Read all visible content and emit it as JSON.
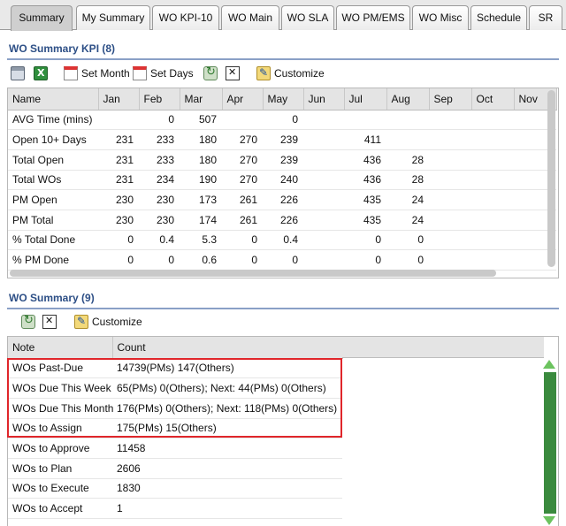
{
  "tabs": [
    {
      "label": "Summary",
      "active": true
    },
    {
      "label": "My Summary"
    },
    {
      "label": "WO KPI-10"
    },
    {
      "label": "WO Main"
    },
    {
      "label": "WO SLA"
    },
    {
      "label": "WO PM/EMS"
    },
    {
      "label": "WO Misc"
    },
    {
      "label": "Schedule"
    },
    {
      "label": "SR"
    }
  ],
  "kpi": {
    "title": "WO Summary KPI (8)",
    "toolbar": {
      "set_month": "Set Month",
      "set_days": "Set Days",
      "customize": "Customize"
    },
    "columns": [
      "Name",
      "Jan",
      "Feb",
      "Mar",
      "Apr",
      "May",
      "Jun",
      "Jul",
      "Aug",
      "Sep",
      "Oct",
      "Nov"
    ],
    "rows": [
      [
        "AVG Time (mins)",
        "",
        "0",
        "507",
        "",
        "0",
        "",
        "",
        "",
        "",
        "",
        ""
      ],
      [
        "Open 10+ Days",
        "231",
        "233",
        "180",
        "270",
        "239",
        "",
        "411",
        "",
        "",
        "",
        ""
      ],
      [
        "Total Open",
        "231",
        "233",
        "180",
        "270",
        "239",
        "",
        "436",
        "28",
        "",
        "",
        ""
      ],
      [
        "Total WOs",
        "231",
        "234",
        "190",
        "270",
        "240",
        "",
        "436",
        "28",
        "",
        "",
        ""
      ],
      [
        "PM Open",
        "230",
        "230",
        "173",
        "261",
        "226",
        "",
        "435",
        "24",
        "",
        "",
        ""
      ],
      [
        "PM Total",
        "230",
        "230",
        "174",
        "261",
        "226",
        "",
        "435",
        "24",
        "",
        "",
        ""
      ],
      [
        "% Total Done",
        "0",
        "0.4",
        "5.3",
        "0",
        "0.4",
        "",
        "0",
        "0",
        "",
        "",
        ""
      ],
      [
        "% PM Done",
        "0",
        "0",
        "0.6",
        "0",
        "0",
        "",
        "0",
        "0",
        "",
        "",
        ""
      ]
    ]
  },
  "summary": {
    "title": "WO Summary (9)",
    "toolbar": {
      "customize": "Customize"
    },
    "columns": [
      "Note",
      "Count"
    ],
    "rows": [
      [
        "WOs Past-Due",
        "14739(PMs) 147(Others)"
      ],
      [
        "WOs Due This Week",
        "65(PMs) 0(Others); Next: 44(PMs) 0(Others)"
      ],
      [
        "WOs Due This Month",
        "176(PMs) 0(Others); Next: 118(PMs) 0(Others)"
      ],
      [
        "WOs to Assign",
        "175(PMs) 15(Others)"
      ],
      [
        "WOs to Approve",
        "11458"
      ],
      [
        "WOs to Plan",
        "2606"
      ],
      [
        "WOs to Execute",
        "1830"
      ],
      [
        "WOs to Accept",
        "1"
      ]
    ]
  },
  "icons": {
    "print": "printer-icon",
    "export": "excel-icon",
    "calendar": "calendar-icon",
    "refresh": "refresh-icon",
    "close": "close-box-icon",
    "customize": "customize-icon"
  },
  "colors": {
    "section_title": "#2d4f86",
    "highlight_box": "#e0262b",
    "scroll_green": "#3a8a3e"
  }
}
